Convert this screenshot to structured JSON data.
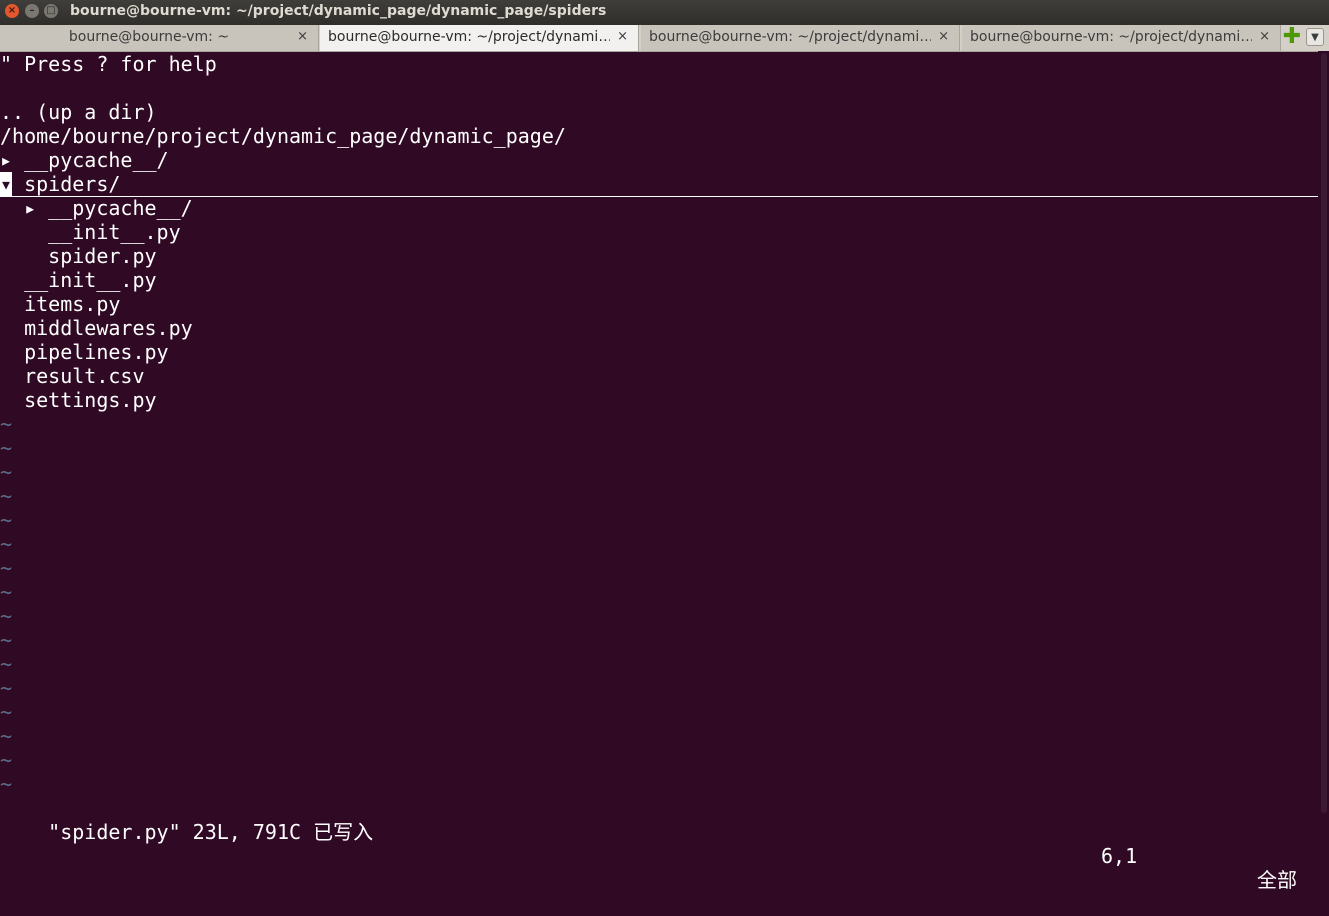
{
  "window": {
    "title": "bourne@bourne-vm: ~/project/dynamic_page/dynamic_page/spiders",
    "close_glyph": "×",
    "min_glyph": "–",
    "max_glyph": "□"
  },
  "tabs": [
    {
      "label": "bourne@bourne-vm: ~",
      "close": "×"
    },
    {
      "label": "bourne@bourne-vm: ~/project/dynami…",
      "close": "×"
    },
    {
      "label": "bourne@bourne-vm: ~/project/dynami…",
      "close": "×"
    },
    {
      "label": "bourne@bourne-vm: ~/project/dynami…",
      "close": "×"
    }
  ],
  "tabbar": {
    "new_tab": "✚",
    "menu": "▼"
  },
  "nerdtree": {
    "help": "\" Press ? for help",
    "up_dir": ".. (up a dir)",
    "root": "/home/bourne/project/dynamic_page/dynamic_page/",
    "entries": [
      {
        "marker": "▸ ",
        "name": "__pycache__/"
      },
      {
        "marker": "▾",
        "name": " spiders/"
      },
      {
        "marker": "  ▸ ",
        "name": "__pycache__/"
      },
      {
        "marker": "    ",
        "name": "__init__.py"
      },
      {
        "marker": "    ",
        "name": "spider.py"
      },
      {
        "marker": "  ",
        "name": "__init__.py"
      },
      {
        "marker": "  ",
        "name": "items.py"
      },
      {
        "marker": "  ",
        "name": "middlewares.py"
      },
      {
        "marker": "  ",
        "name": "pipelines.py"
      },
      {
        "marker": "  ",
        "name": "result.csv"
      },
      {
        "marker": "  ",
        "name": "settings.py"
      }
    ],
    "tilde": "~"
  },
  "statusline": {
    "message": "\"spider.py\" 23L, 791C 已写入",
    "position": "6,1",
    "scroll": "全部"
  }
}
